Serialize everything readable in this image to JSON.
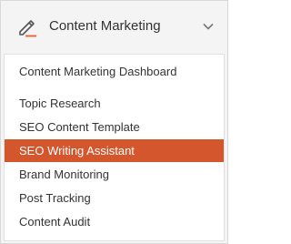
{
  "header": {
    "title": "Content Marketing",
    "icon": "pencil-icon",
    "accent_color": "#e8693d"
  },
  "menu": {
    "items": [
      {
        "label": "Content Marketing Dashboard",
        "active": false
      },
      {
        "label": "Topic Research",
        "active": false
      },
      {
        "label": "SEO Content Template",
        "active": false
      },
      {
        "label": "SEO Writing Assistant",
        "active": true
      },
      {
        "label": "Brand Monitoring",
        "active": false
      },
      {
        "label": "Post Tracking",
        "active": false
      },
      {
        "label": "Content Audit",
        "active": false
      }
    ],
    "active_color": "#d4562c"
  }
}
